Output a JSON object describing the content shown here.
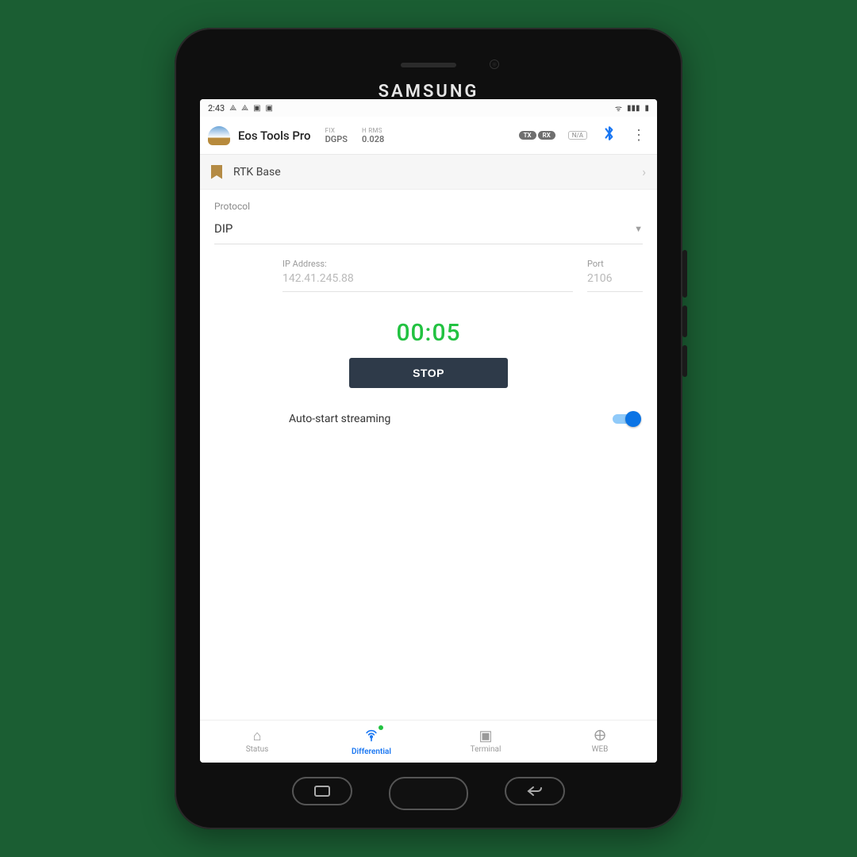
{
  "device": {
    "brand": "SAMSUNG"
  },
  "statusbar": {
    "time": "2:43",
    "left_icons": [
      "⤒",
      "⤒",
      "🄰",
      "✕"
    ],
    "right_icons": [
      "📶",
      "📶",
      "🔋"
    ]
  },
  "header": {
    "title": "Eos Tools Pro",
    "fix_label": "FIX",
    "fix_value": "DGPS",
    "hrms_label": "H RMS",
    "hrms_value": "0.028",
    "tx": "TX",
    "rx": "RX",
    "na": "N/A"
  },
  "bookmark": {
    "label": "RTK Base"
  },
  "protocol": {
    "label": "Protocol",
    "value": "DIP"
  },
  "ip": {
    "label": "IP Address:",
    "value": "142.41.245.88"
  },
  "port": {
    "label": "Port",
    "value": "2106"
  },
  "timer": "00:05",
  "stop_label": "STOP",
  "autostart": {
    "label": "Auto-start streaming",
    "on": true
  },
  "nav": {
    "status": "Status",
    "differential": "Differential",
    "terminal": "Terminal",
    "web": "WEB"
  }
}
